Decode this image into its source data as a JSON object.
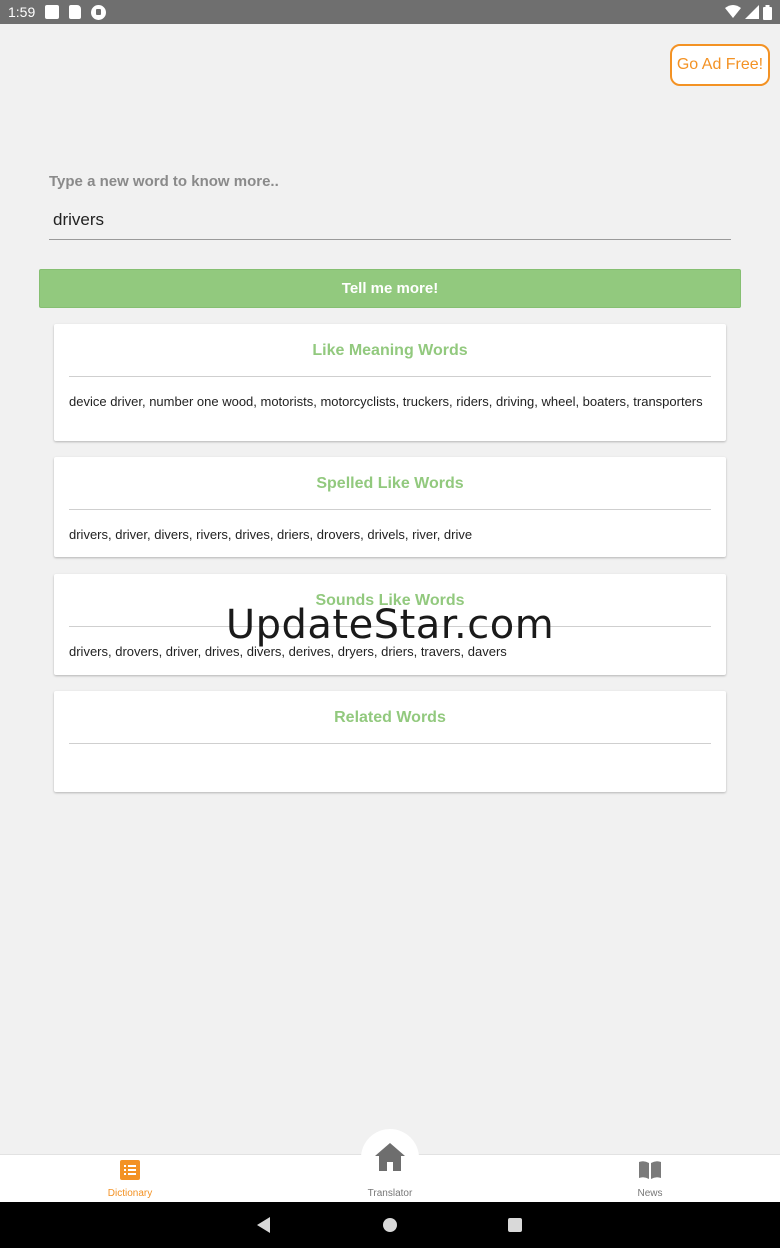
{
  "status_bar": {
    "time": "1:59"
  },
  "header": {
    "ad_free_label": "Go Ad Free!"
  },
  "search": {
    "label": "Type a new word to know more..",
    "value": "drivers",
    "submit_label": "Tell me more!"
  },
  "sections": [
    {
      "title": "Like Meaning Words",
      "body": "device driver, number one wood, motorists, motorcyclists, truckers, riders, driving, wheel, boaters, transporters"
    },
    {
      "title": "Spelled Like Words",
      "body": "drivers, driver, divers, rivers, drives, driers, drovers, drivels, river, drive"
    },
    {
      "title": "Sounds Like Words",
      "body": "drivers, drovers, driver, drives, divers, derives, dryers, driers, travers, davers"
    },
    {
      "title": "Related Words",
      "body": ""
    }
  ],
  "watermark": "UpdateStar.com",
  "bottom_nav": {
    "dictionary": "Dictionary",
    "translator": "Translator",
    "news": "News"
  },
  "colors": {
    "accent_green": "#92c97e",
    "accent_orange": "#f39224"
  },
  "icons": {
    "dictionary": "list-icon",
    "translator": "home-icon",
    "news": "book-icon"
  }
}
